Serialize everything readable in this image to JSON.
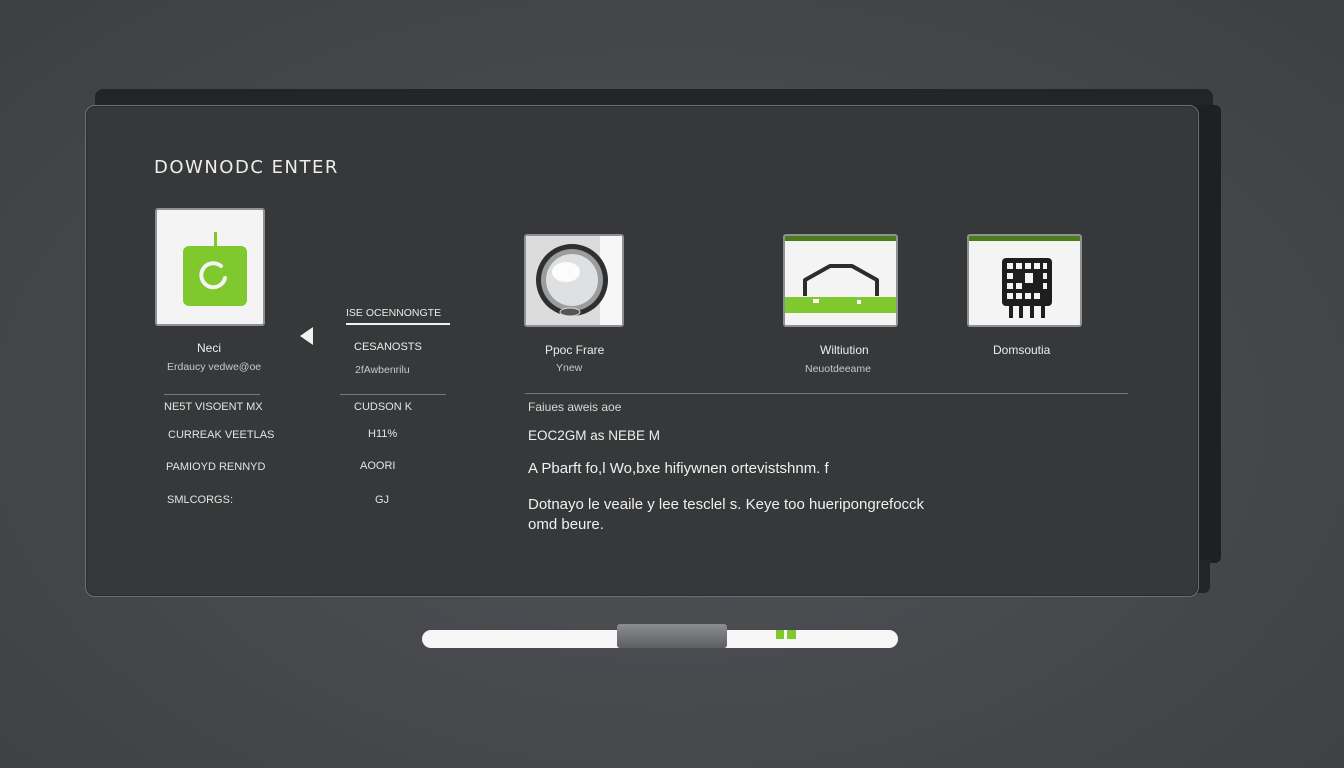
{
  "title": "DOWNODC ENTER",
  "tiles": [
    {
      "label": "Neci",
      "sub": "Erdaucy vedwe@oe",
      "icon": "power-icon"
    },
    {
      "label": "Ppoc Frare",
      "sub": "Ynew",
      "icon": "disc-icon"
    },
    {
      "label": "Wiltiution",
      "sub": "Neuotdeeame",
      "icon": "house-icon"
    },
    {
      "label": "Domsoutia",
      "sub": "",
      "icon": "chip-icon"
    }
  ],
  "column_header": "ISE OCENNONGTE",
  "middle": {
    "label": "CESANOSTS",
    "sub": "2fAwbenrilu"
  },
  "rows": [
    {
      "name": "NE5T VISOENT MX",
      "value": "CUDSON K"
    },
    {
      "name": "CURREAK VEETLAS",
      "value": "H11%"
    },
    {
      "name": "PAMIOYD RENNYD",
      "value": "AOORI"
    },
    {
      "name": "SMLCORGS:",
      "value": "GJ"
    }
  ],
  "details": {
    "line1": "Faiues aweis aoe",
    "line2": "EOC2GM as NEBE M",
    "line3": "A Pbarft fo,l Wo,bxe hifiywnen ortevistshnm. f",
    "line4a": "Dotnayo le veaile y lee tesclel s. Keye too hueripongrefocck",
    "line4b": "omd beure."
  },
  "slider": {
    "position": 0.41
  }
}
